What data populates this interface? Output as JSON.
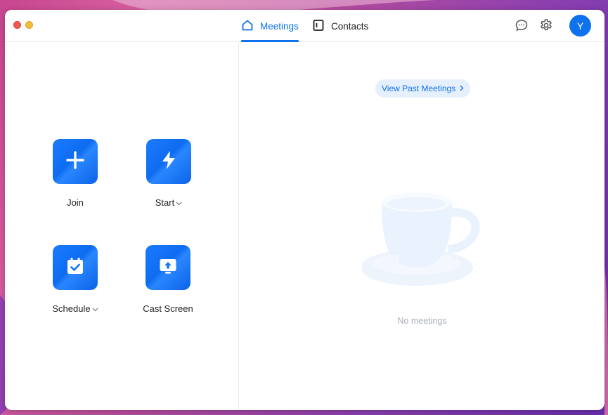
{
  "window": {
    "tabs": [
      {
        "label": "Meetings",
        "icon": "home-icon",
        "active": true
      },
      {
        "label": "Contacts",
        "icon": "contacts-icon",
        "active": false
      }
    ],
    "avatar_initial": "Y",
    "accent_color": "#0e72ed"
  },
  "actions": {
    "join": {
      "label": "Join",
      "icon": "plus-icon"
    },
    "start": {
      "label": "Start",
      "icon": "lightning-icon",
      "has_dropdown": true
    },
    "schedule": {
      "label": "Schedule",
      "icon": "calendar-check-icon",
      "has_dropdown": true
    },
    "cast": {
      "label": "Cast Screen",
      "icon": "cast-screen-icon"
    }
  },
  "meetings": {
    "view_past_label": "View Past Meetings",
    "empty_text": "No meetings"
  }
}
